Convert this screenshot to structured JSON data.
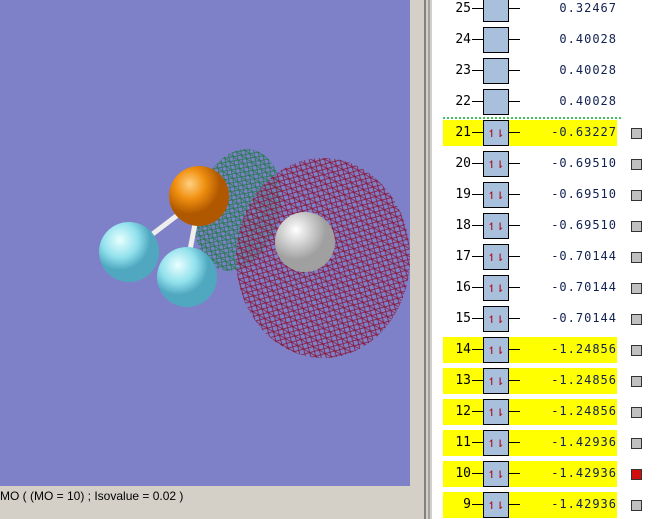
{
  "status_text": "MO ( (MO = 10) ; Isovalue = 0.02 )",
  "orbitals": [
    {
      "n": "25",
      "energy": "0.32467",
      "occupied": false
    },
    {
      "n": "24",
      "energy": "0.40028",
      "occupied": false
    },
    {
      "n": "23",
      "energy": "0.40028",
      "occupied": false
    },
    {
      "n": "22",
      "energy": "0.40028",
      "occupied": false
    },
    {
      "n": "21",
      "energy": "-0.63227",
      "occupied": true,
      "highlight": true
    },
    {
      "n": "20",
      "energy": "-0.69510",
      "occupied": true
    },
    {
      "n": "19",
      "energy": "-0.69510",
      "occupied": true
    },
    {
      "n": "18",
      "energy": "-0.69510",
      "occupied": true
    },
    {
      "n": "17",
      "energy": "-0.70144",
      "occupied": true
    },
    {
      "n": "16",
      "energy": "-0.70144",
      "occupied": true
    },
    {
      "n": "15",
      "energy": "-0.70144",
      "occupied": true
    },
    {
      "n": "14",
      "energy": "-1.24856",
      "occupied": true,
      "highlight": true
    },
    {
      "n": "13",
      "energy": "-1.24856",
      "occupied": true,
      "highlight": true
    },
    {
      "n": "12",
      "energy": "-1.24856",
      "occupied": true,
      "highlight": true
    },
    {
      "n": "11",
      "energy": "-1.42936",
      "occupied": true,
      "highlight": true
    },
    {
      "n": "10",
      "energy": "-1.42936",
      "occupied": true,
      "highlight": true,
      "selected": true
    },
    {
      "n": "9",
      "energy": "-1.42936",
      "occupied": true,
      "highlight": true
    }
  ],
  "electron_pair_glyph": "↿⇂",
  "colors": {
    "viewport": "#7e80c8",
    "highlight": "#ffff00",
    "selected": "#d01010"
  }
}
